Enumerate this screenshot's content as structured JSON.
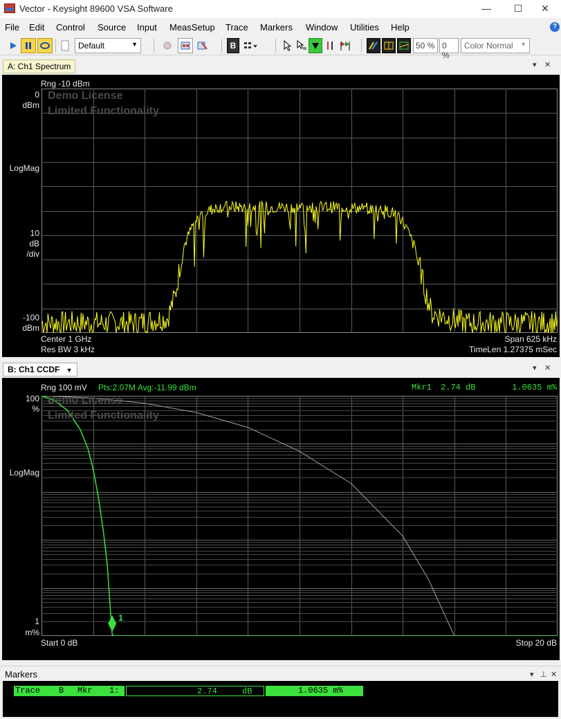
{
  "window": {
    "title": "Vector - Keysight 89600 VSA Software",
    "minimize": "—",
    "maximize": "☐",
    "close": "✕"
  },
  "menu": [
    "File",
    "Edit",
    "Control",
    "Source",
    "Input",
    "MeasSetup",
    "Trace",
    "Markers",
    "Window",
    "Utilities",
    "Help"
  ],
  "toolbar": {
    "preset": "Default",
    "scale_pct_1": "50 %",
    "scale_pct_2": "0 %",
    "color_mode": "Color Normal"
  },
  "panel_a": {
    "tab": "A: Ch1 Spectrum",
    "range": "Rng -10 dBm",
    "y_top": "0",
    "y_top_unit": "dBm",
    "y_format": "LogMag",
    "scale_1": "10",
    "scale_2": "dB",
    "scale_3": "/div",
    "y_bottom": "-100",
    "y_bottom_unit": "dBm",
    "center": "Center 1 GHz",
    "res_bw": "Res BW 3 kHz",
    "span": "Span 625 kHz",
    "timelen": "TimeLen 1.27375 mSec",
    "watermark_1": "Demo License",
    "watermark_2": "Limited Functionality",
    "trace_color": "#ffff1e",
    "chart_data": {
      "type": "line",
      "xlabel": "",
      "ylabel": "LogMag",
      "xlim": [
        -312.5,
        312.5
      ],
      "x_unit": "kHz (offset from 1 GHz)",
      "ylim": [
        -100,
        0
      ],
      "y_unit": "dBm",
      "grid": true,
      "series": [
        {
          "x": [
            -312,
            -250,
            -200,
            -160,
            -150,
            -140,
            -130,
            -120,
            -100,
            -50,
            0,
            50,
            100,
            120,
            130,
            140,
            150,
            160,
            200,
            250,
            312
          ],
          "values": [
            -96,
            -96,
            -96,
            -94,
            -84,
            -62,
            -54,
            -49,
            -46,
            -46,
            -46,
            -46,
            -47,
            -49,
            -55,
            -63,
            -80,
            -92,
            -96,
            -96,
            -96
          ]
        }
      ]
    }
  },
  "panel_b": {
    "tab": "B: Ch1 CCDF",
    "range": "Rng 100 mV",
    "stats": "Pts:2.07M Avg:-11.99 dBm",
    "marker_readout_label": "Mkr1",
    "marker_readout_value": "2.74  dB",
    "marker_readout_pct": "1.0635 m%",
    "y_top": "100",
    "y_top_unit": "%",
    "y_format": "LogMag",
    "y_bottom": "1",
    "y_bottom_unit": "m%",
    "start": "Start 0 dB",
    "stop": "Stop 20 dB",
    "marker_label": "1",
    "watermark_1": "Demo License",
    "watermark_2": "Limited Functionality",
    "trace_color": "#3ce03c",
    "ref_color": "#a0a0a0",
    "chart_data": {
      "type": "line",
      "xlabel": "",
      "ylabel": "LogMag",
      "xlim": [
        0,
        20
      ],
      "x_unit": "dB",
      "ylim_percent": [
        0.001,
        100
      ],
      "y_scale": "log",
      "grid": true,
      "series": [
        {
          "name": "",
          "x": [
            0,
            0.5,
            1,
            1.5,
            1.8,
            2.0,
            2.2,
            2.4,
            2.55,
            2.65,
            2.74,
            2.8,
            20
          ],
          "values": [
            100,
            80,
            50,
            20,
            8,
            3,
            0.8,
            0.15,
            0.03,
            0.005,
            0.0010635,
            0.001,
            0.001
          ]
        },
        {
          "name": "",
          "x": [
            0,
            2,
            4,
            6,
            8,
            10,
            12,
            14,
            15,
            16
          ],
          "values": [
            100,
            90,
            70,
            45,
            22,
            7,
            1.5,
            0.12,
            0.015,
            0.001
          ]
        }
      ],
      "marker": {
        "x": 2.74,
        "y_percent": 0.0010635
      }
    }
  },
  "markers": {
    "title": "Markers",
    "row": {
      "trace": "Trace",
      "trace_id": "B",
      "mkr": "Mkr",
      "mkr_id": "1:",
      "value": "2.74",
      "unit": "dB",
      "pct": "1.0635 m%"
    }
  }
}
